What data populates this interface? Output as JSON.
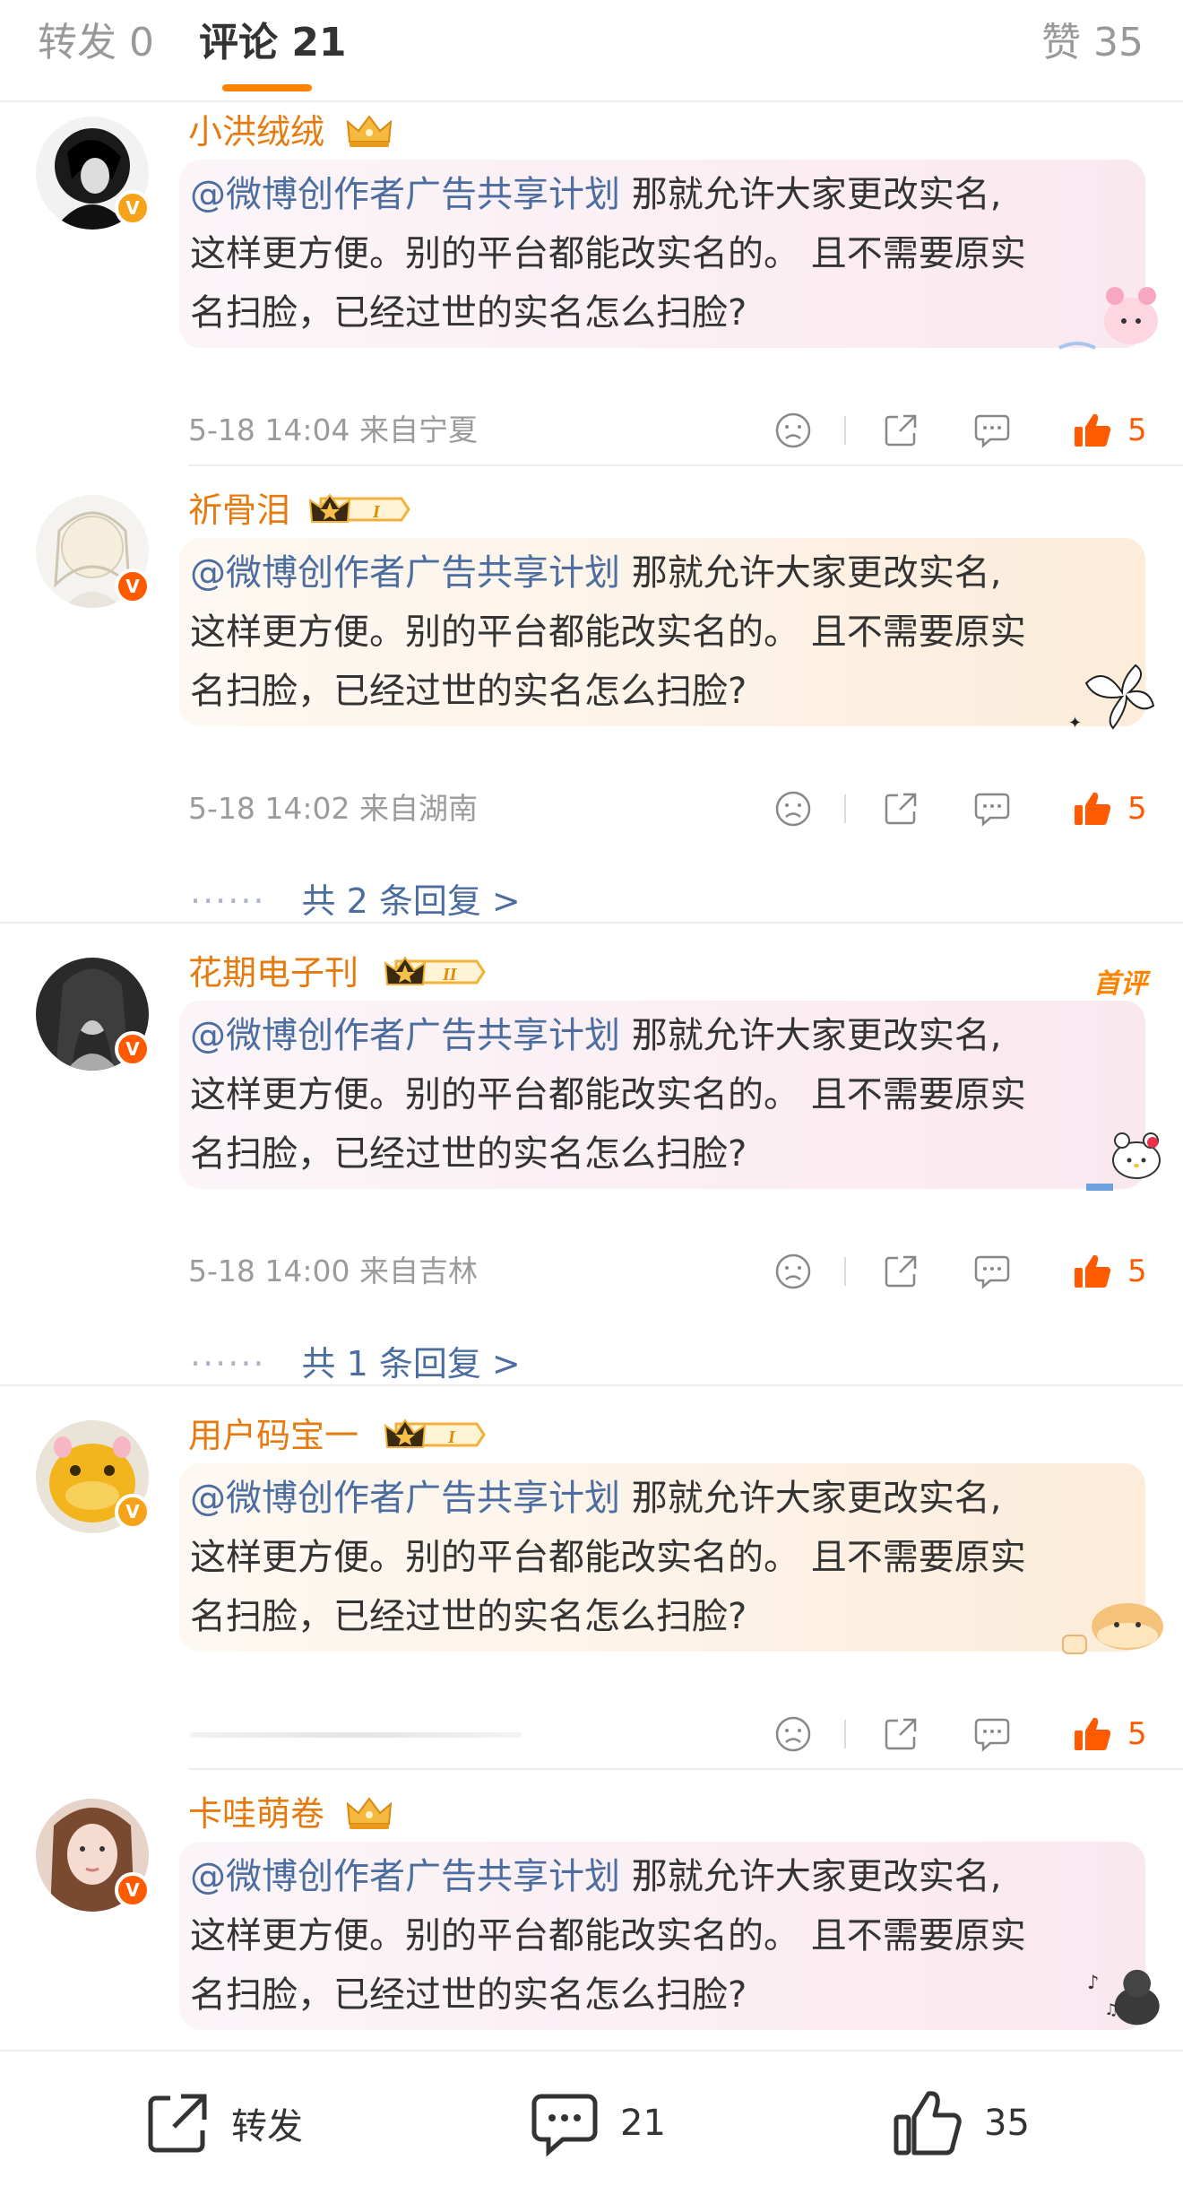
{
  "tabs": {
    "repost": "转发 0",
    "comments": "评论 21",
    "likes": "赞 35"
  },
  "colors": {
    "accent": "#ff8200",
    "username": "#e57b0f",
    "mention": "#4b6d9f",
    "like_active": "#ff5a00"
  },
  "comments": [
    {
      "username": "小洪绒绒",
      "mention": "@微博创作者广告共享计划",
      "text_line1": " 那就允许大家更改实名,",
      "text_line2": "这样更方便。别的平台都能改实名的。 且不需要原实",
      "text_line3": "名扫脸，已经过世的实名怎么扫脸?",
      "meta": "5-18 14:04  来自宁夏",
      "likes": "5",
      "badge": "crown-gold",
      "sticker": "melody-sticker"
    },
    {
      "username": "祈骨泪",
      "mention": "@微博创作者广告共享计划",
      "text_line1": " 那就允许大家更改实名,",
      "text_line2": "这样更方便。别的平台都能改实名的。 且不需要原实",
      "text_line3": "名扫脸，已经过世的实名怎么扫脸?",
      "meta": "5-18 14:02  来自湖南",
      "likes": "5",
      "replies": "共 2 条回复 >",
      "badge_level": "I",
      "sticker": "butterfly-sticker"
    },
    {
      "username": "花期电子刊",
      "mention": "@微博创作者广告共享计划",
      "text_line1": " 那就允许大家更改实名,",
      "text_line2": "这样更方便。别的平台都能改实名的。 且不需要原实",
      "text_line3": "名扫脸，已经过世的实名怎么扫脸?",
      "meta": "5-18 14:00  来自吉林",
      "likes": "5",
      "replies": "共 1 条回复 >",
      "first_tag": "首评",
      "badge_level": "II",
      "sticker": "hello-kitty-sticker"
    },
    {
      "username": "用户码宝一",
      "mention": "@微博创作者广告共享计划",
      "text_line1": " 那就允许大家更改实名,",
      "text_line2": "这样更方便。别的平台都能改实名的。 且不需要原实",
      "text_line3": "名扫脸，已经过世的实名怎么扫脸?",
      "likes": "5",
      "badge_level": "I",
      "sticker": "shiba-bread-sticker"
    },
    {
      "username": "卡哇萌卷",
      "mention": "@微博创作者广告共享计划",
      "text_line1": " 那就允许大家更改实名,",
      "text_line2": "这样更方便。别的平台都能改实名的。 且不需要原实",
      "text_line3": "名扫脸，已经过世的实名怎么扫脸?",
      "badge": "crown-gold",
      "sticker": "cat-music-sticker"
    }
  ],
  "bottombar": {
    "repost_label": "转发",
    "comment_count": "21",
    "like_count": "35"
  }
}
